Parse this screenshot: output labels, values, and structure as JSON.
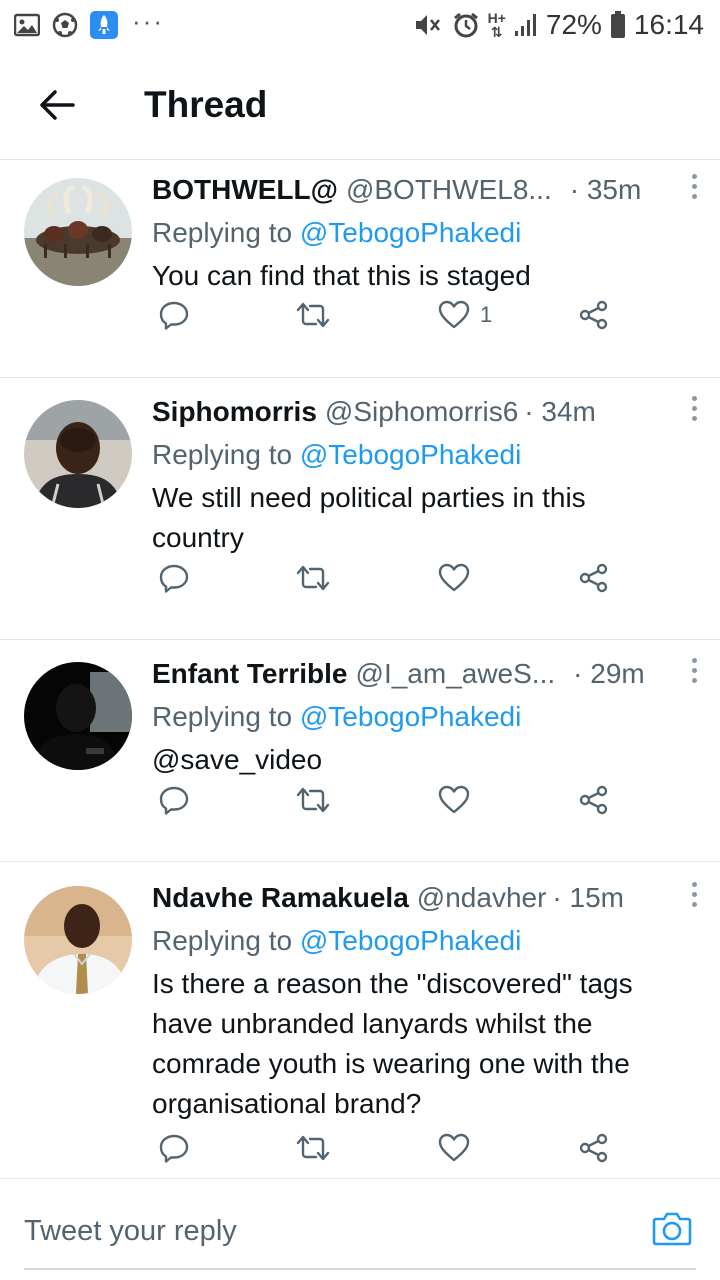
{
  "status_bar": {
    "battery": "72%",
    "time": "16:14",
    "network": "H+"
  },
  "header": {
    "title": "Thread"
  },
  "tweets": [
    {
      "author": "BOTHWELL@",
      "handle": "@BOTHWEL8...",
      "time": "· 35m",
      "replying_prefix": "Replying to",
      "replying_to": "@TebogoPhakedi",
      "text": "You can find that this is staged",
      "likes": "1"
    },
    {
      "author": "Siphomorris",
      "handle": "@Siphomorris6",
      "time": "· 34m",
      "replying_prefix": "Replying to",
      "replying_to": "@TebogoPhakedi",
      "text": "We still need political parties in this country",
      "likes": ""
    },
    {
      "author": "Enfant Terrible",
      "handle": "@I_am_aweS...",
      "time": "· 29m",
      "replying_prefix": "Replying to",
      "replying_to": "@TebogoPhakedi",
      "text": "@save_video",
      "likes": ""
    },
    {
      "author": "Ndavhe Ramakuela",
      "handle": "@ndavher",
      "time": "· 15m",
      "replying_prefix": "Replying to",
      "replying_to": "@TebogoPhakedi",
      "text": "Is there a reason the \"discovered\" tags have unbranded lanyards whilst the comrade youth is wearing one with the organisational brand?",
      "likes": ""
    }
  ],
  "reply_bar": {
    "placeholder": "Tweet your reply"
  },
  "colors": {
    "accent": "#1d9bf0",
    "secondary_text": "#536471",
    "divider": "#e1e6ea"
  }
}
